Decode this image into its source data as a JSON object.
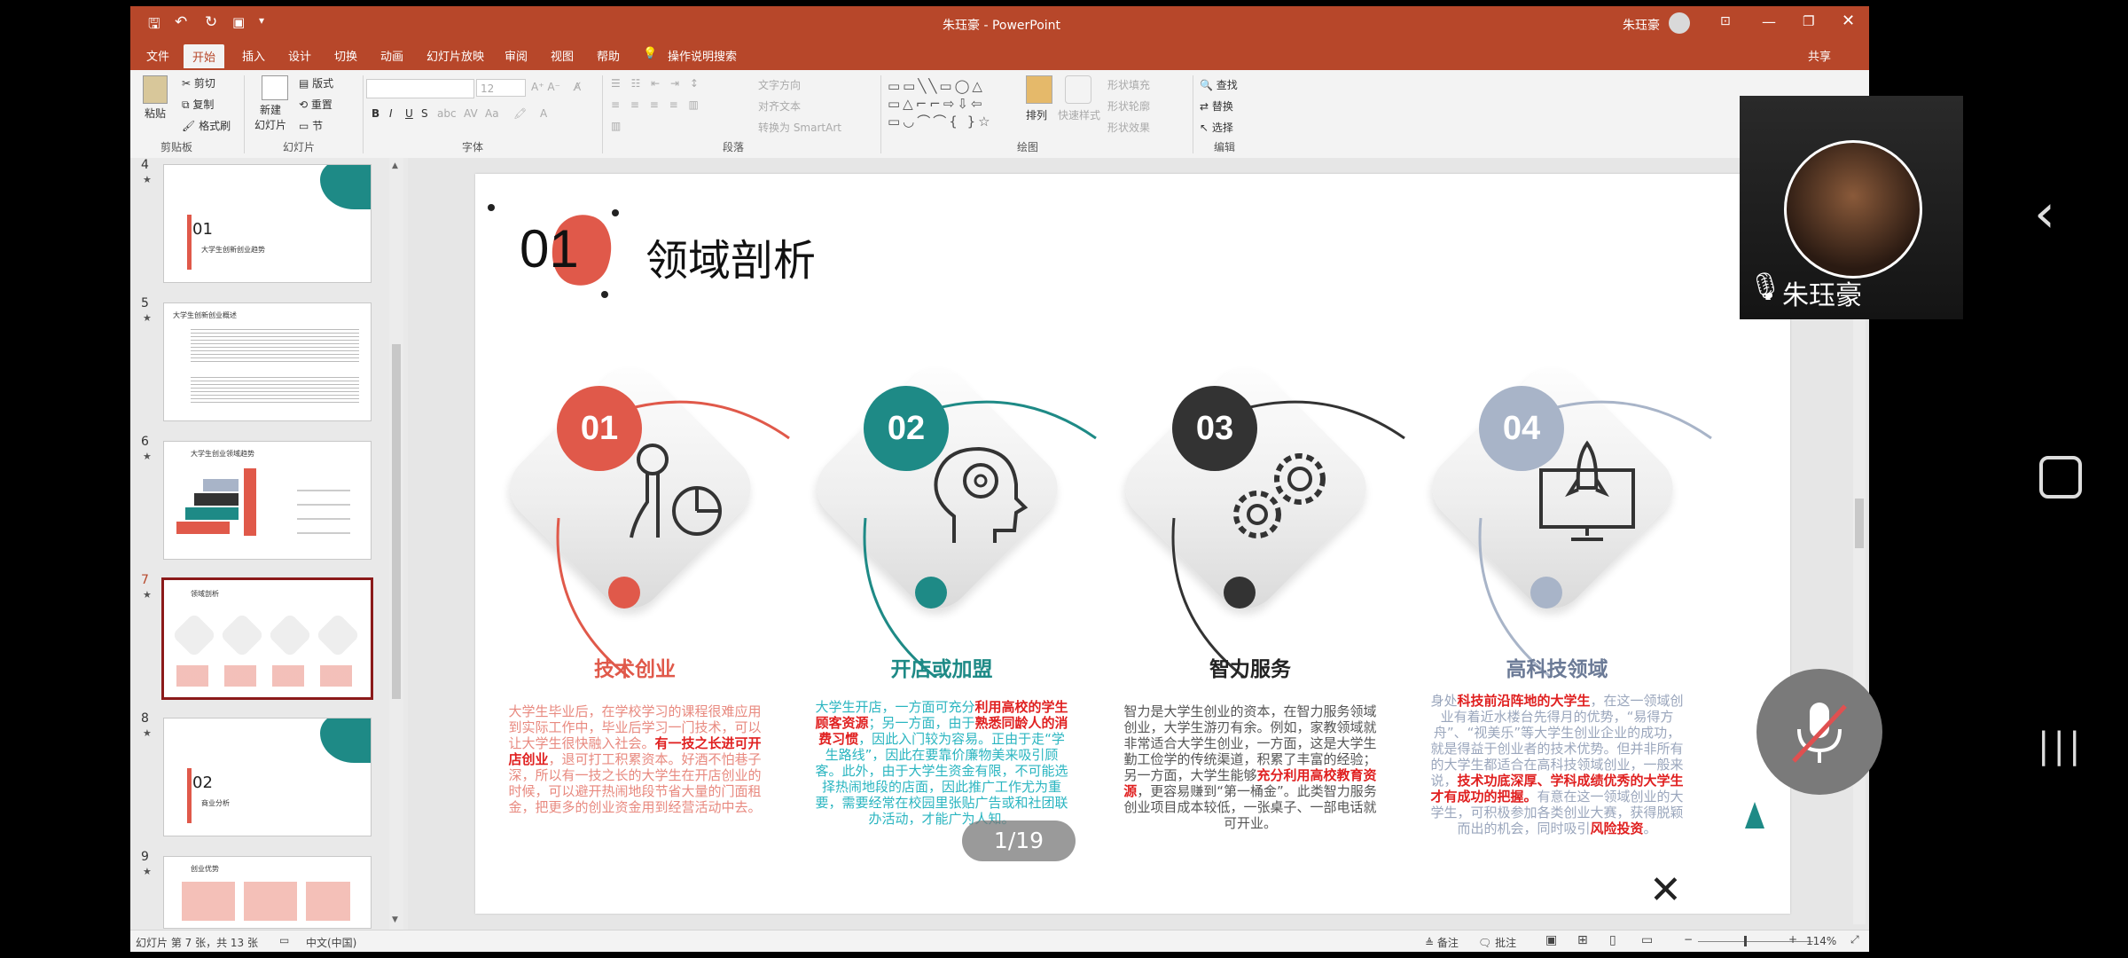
{
  "window": {
    "title": "朱珏豪 - PowerPoint",
    "user": "朱珏豪",
    "share": "共享"
  },
  "ribbon_tabs": [
    "文件",
    "开始",
    "插入",
    "设计",
    "切换",
    "动画",
    "幻灯片放映",
    "审阅",
    "视图",
    "帮助",
    "操作说明搜索"
  ],
  "ribbon": {
    "clipboard": {
      "paste": "粘贴",
      "cut": "剪切",
      "copy": "复制",
      "format_painter": "格式刷",
      "label": "剪贴板"
    },
    "slides": {
      "new_slide": "新建\n幻灯片",
      "layout": "版式",
      "reset": "重置",
      "section": "节",
      "label": "幻灯片"
    },
    "font": {
      "size": "12",
      "label": "字体"
    },
    "paragraph": {
      "text_direction": "文字方向",
      "align_text": "对齐文本",
      "smartart": "转换为 SmartArt",
      "label": "段落"
    },
    "drawing": {
      "arrange": "排列",
      "quick_styles": "快速样式",
      "shape_fill": "形状填充",
      "shape_outline": "形状轮廓",
      "shape_effects": "形状效果",
      "label": "绘图"
    },
    "editing": {
      "find": "查找",
      "replace": "替换",
      "select": "选择",
      "label": "编辑"
    }
  },
  "thumbnails": [
    {
      "num": "4",
      "caption": "大学生创新创业趋势",
      "big": "01"
    },
    {
      "num": "5",
      "caption": "大学生创新创业概述",
      "big": ""
    },
    {
      "num": "6",
      "caption": "大学生创业领域趋势",
      "big": ""
    },
    {
      "num": "7",
      "caption": "领域剖析",
      "big": ""
    },
    {
      "num": "8",
      "caption": "商业分析",
      "big": "02"
    },
    {
      "num": "9",
      "caption": "创业优势",
      "big": ""
    }
  ],
  "slide": {
    "number": "01",
    "title": "领域剖析",
    "cards": [
      {
        "badge": "01",
        "color": "#e0594a",
        "title": "技术创业",
        "icon": "person-chart-icon",
        "text_color": "#e8897f",
        "segments": [
          {
            "t": "大学生毕业后，在学校学习的课程很难应用到实际工作中，毕业后学习一门技术，可以让大学生很快融入社会。",
            "red": false
          },
          {
            "t": "有一技之长进可开店创业",
            "red": true
          },
          {
            "t": "，退可打工积累资本。好酒不怕巷子深，所以有一技之长的大学生在开店创业的时候，可以避开热闹地段节省大量的门面租金，把更多的创业资金用到经营活动中去。",
            "red": false
          }
        ]
      },
      {
        "badge": "02",
        "color": "#1e8a86",
        "title": "开店或加盟",
        "icon": "head-gear-icon",
        "text_color": "#2ab5c0",
        "segments": [
          {
            "t": "大学生开店，一方面可充分",
            "red": false
          },
          {
            "t": "利用高校的学生顾客资源",
            "red": true
          },
          {
            "t": "；另一方面，由于",
            "red": false
          },
          {
            "t": "熟悉同龄人的消费习惯",
            "red": true
          },
          {
            "t": "，因此入门较为容易。正由于走“学生路线”，因此在要靠价廉物美来吸引顾客。此外，由于大学生资金有限，不可能选择热闹地段的店面，因此推广工作尤为重要，需要经常在校园里张贴广告或和社团联办活动，才能广为人知。",
            "red": false
          }
        ]
      },
      {
        "badge": "03",
        "color": "#333333",
        "title": "智力服务",
        "icon": "gears-icon",
        "text_color": "#555555",
        "segments": [
          {
            "t": "智力是大学生创业的资本，在智力服务领域创业，大学生游刃有余。例如，家教领域就非常适合大学生创业，一方面，这是大学生勤工俭学的传统渠道，积累了丰富的经验；另一方面，大学生能够",
            "red": false
          },
          {
            "t": "充分利用高校教育资源",
            "red": true
          },
          {
            "t": "，更容易赚到“第一桶金”。此类智力服务创业项目成本较低，一张桌子、一部电话就可开业。",
            "red": false
          }
        ]
      },
      {
        "badge": "04",
        "color": "#a8b4c8",
        "title": "高科技领域",
        "icon": "rocket-monitor-icon",
        "text_color": "#9aa6bc",
        "segments": [
          {
            "t": "身处",
            "red": false
          },
          {
            "t": "科技前沿阵地的大学生",
            "red": true
          },
          {
            "t": "，在这一领域创业有着近水楼台先得月的优势，“易得方舟”、“视美乐”等大学生创业企业的成功，就是得益于创业者的技术优势。但并非所有的大学生都适合在高科技领域创业，一般来说，",
            "red": false
          },
          {
            "t": "技术功底深厚、学科成绩优秀的大学生才有成功的把握。",
            "red": true
          },
          {
            "t": "有意在这一领域创业的大学生，可积极参加各类创业大赛，获得脱颖而出的机会，同时吸引",
            "red": false
          },
          {
            "t": "风险投资",
            "red": true
          },
          {
            "t": "。",
            "red": false
          }
        ]
      }
    ]
  },
  "page_indicator": "1/19",
  "status": {
    "slide_info": "幻灯片 第 7 张，共 13 张",
    "language": "中文(中国)",
    "notes": "备注",
    "comments": "批注",
    "zoom": "114%"
  },
  "video": {
    "name": "朱珏豪"
  },
  "colors": {
    "ppt_red": "#b7472a",
    "mic_bg": "#7a7a7a"
  }
}
